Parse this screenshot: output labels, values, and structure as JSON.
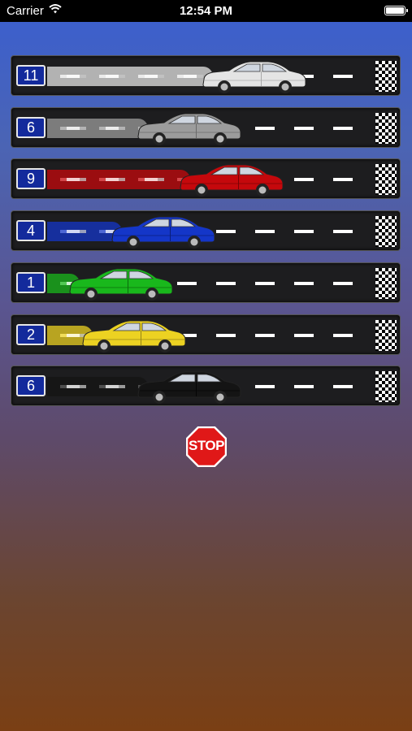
{
  "status_bar": {
    "carrier": "Carrier",
    "time": "12:54 PM"
  },
  "lanes": [
    {
      "number": "11",
      "car_color": "#e4e4e4",
      "car_color_dark": "#a9a9a9",
      "progress": 0.55
    },
    {
      "number": "6",
      "car_color": "#9c9c9c",
      "car_color_dark": "#6a6a6a",
      "progress": 0.35
    },
    {
      "number": "9",
      "car_color": "#c5080c",
      "car_color_dark": "#7a0204",
      "progress": 0.48
    },
    {
      "number": "4",
      "car_color": "#1436c8",
      "car_color_dark": "#0a1d78",
      "progress": 0.27
    },
    {
      "number": "1",
      "car_color": "#19b81c",
      "car_color_dark": "#0b6b0d",
      "progress": 0.14
    },
    {
      "number": "2",
      "car_color": "#ecd222",
      "car_color_dark": "#958417",
      "progress": 0.18
    },
    {
      "number": "6",
      "car_color": "#141414",
      "car_color_dark": "#050505",
      "progress": 0.35
    }
  ],
  "stop_button": {
    "label": "STOP",
    "color": "#e01818"
  }
}
